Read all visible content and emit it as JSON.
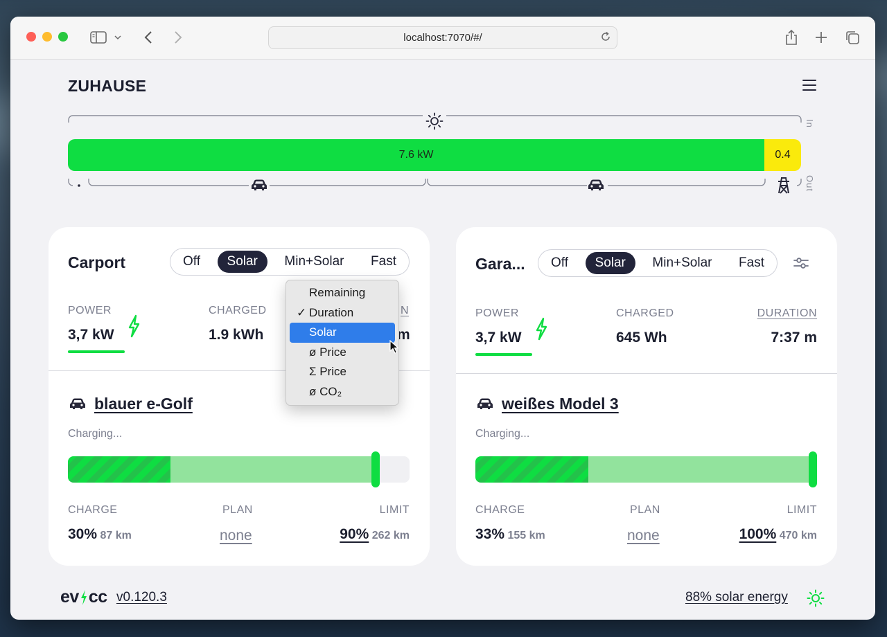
{
  "browser": {
    "url": "localhost:7070/#/"
  },
  "site": {
    "title": "ZUHAUSE"
  },
  "energy": {
    "solar_label": "7.6 kW",
    "grid_label": "0.4",
    "in_label": "In",
    "out_label": "Out",
    "solar_fraction": 0.95,
    "colors": {
      "solar": "#0fdd42",
      "grid": "#faea0c"
    }
  },
  "loadpoints": [
    {
      "title": "Carport",
      "modes": [
        "Off",
        "Solar",
        "Min+Solar",
        "Fast"
      ],
      "active_mode": "Solar",
      "power_label": "POWER",
      "power_value": "3,7 kW",
      "charged_label": "CHARGED",
      "charged_value": "1.9 kWh",
      "third_label_partial": "N",
      "third_value_partial": "m",
      "vehicle": "blauer e-Golf",
      "status": "Charging...",
      "soc_percent": 30,
      "limit_percent": 90,
      "charge_label": "CHARGE",
      "charge_value": "30%",
      "charge_km": "87 km",
      "plan_label": "PLAN",
      "plan_value": "none",
      "limit_label": "LIMIT",
      "limit_value": "90%",
      "limit_km": "262 km"
    },
    {
      "title": "Gara...",
      "modes": [
        "Off",
        "Solar",
        "Min+Solar",
        "Fast"
      ],
      "active_mode": "Solar",
      "power_label": "POWER",
      "power_value": "3,7 kW",
      "charged_label": "CHARGED",
      "charged_value": "645 Wh",
      "duration_label": "DURATION",
      "duration_value": "7:37 m",
      "vehicle": "weißes Model 3",
      "status": "Charging...",
      "soc_percent": 33,
      "limit_percent": 100,
      "charge_label": "CHARGE",
      "charge_value": "33%",
      "charge_km": "155 km",
      "plan_label": "PLAN",
      "plan_value": "none",
      "limit_label": "LIMIT",
      "limit_value": "100%",
      "limit_km": "470 km"
    }
  ],
  "dropdown": {
    "items": [
      "Remaining",
      "Duration",
      "Solar",
      "ø Price",
      "Σ Price",
      "ø CO₂"
    ],
    "checked": "Duration",
    "highlighted": "Solar"
  },
  "footer": {
    "logo": "evcc",
    "version": "v0.120.3",
    "solar_energy": "88% solar energy"
  },
  "icons": [
    "sidebar-icon",
    "chevron-down-icon",
    "back-icon",
    "forward-icon",
    "reload-icon",
    "share-icon",
    "new-tab-icon",
    "tabs-icon",
    "menu-icon",
    "sun-icon",
    "car-icon",
    "grid-tower-icon",
    "bolt-icon",
    "settings-sliders-icon"
  ]
}
